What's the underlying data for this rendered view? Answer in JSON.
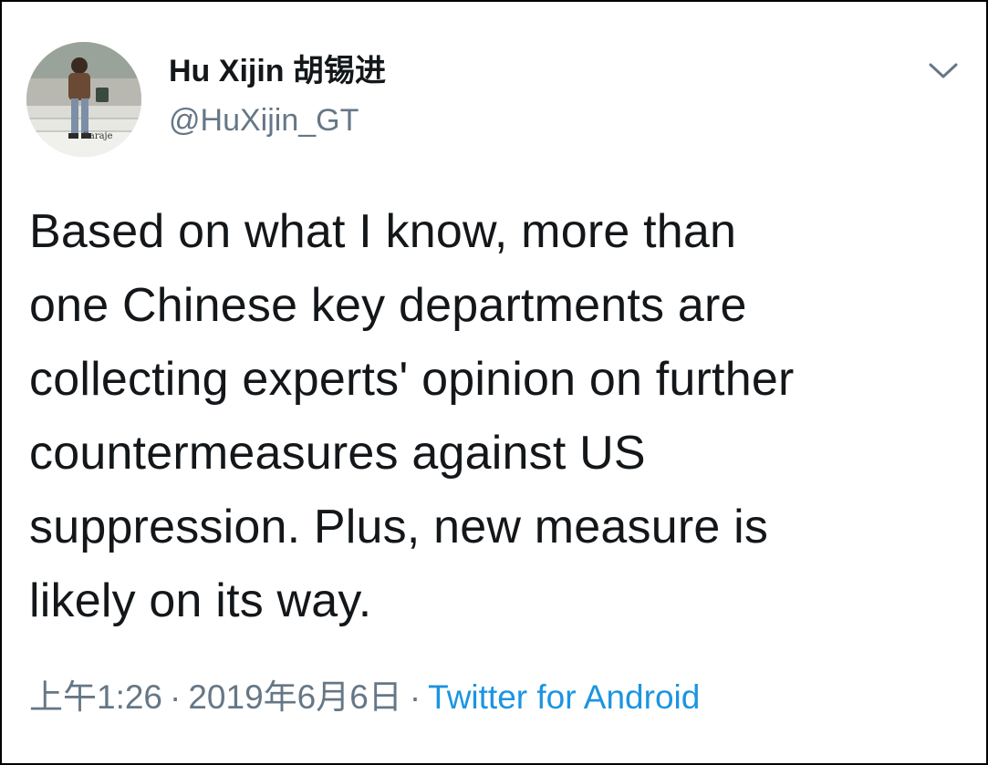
{
  "user": {
    "display_name": "Hu Xijin 胡锡进",
    "handle": "@HuXijin_GT",
    "avatar_caption": "Saraje"
  },
  "tweet": {
    "text": "Based on what I know, more than\none Chinese key departments are\ncollecting experts' opinion on further\ncountermeasures against US\nsuppression. Plus, new measure is\nlikely on its way."
  },
  "meta": {
    "time": "上午1:26",
    "separator": "·",
    "date": "2019年6月6日",
    "source": "Twitter for Android"
  },
  "icons": {
    "menu": "chevron-down-icon"
  },
  "colors": {
    "text_primary": "#14171a",
    "text_secondary": "#657786",
    "link": "#1b95e0",
    "border": "#000000"
  }
}
